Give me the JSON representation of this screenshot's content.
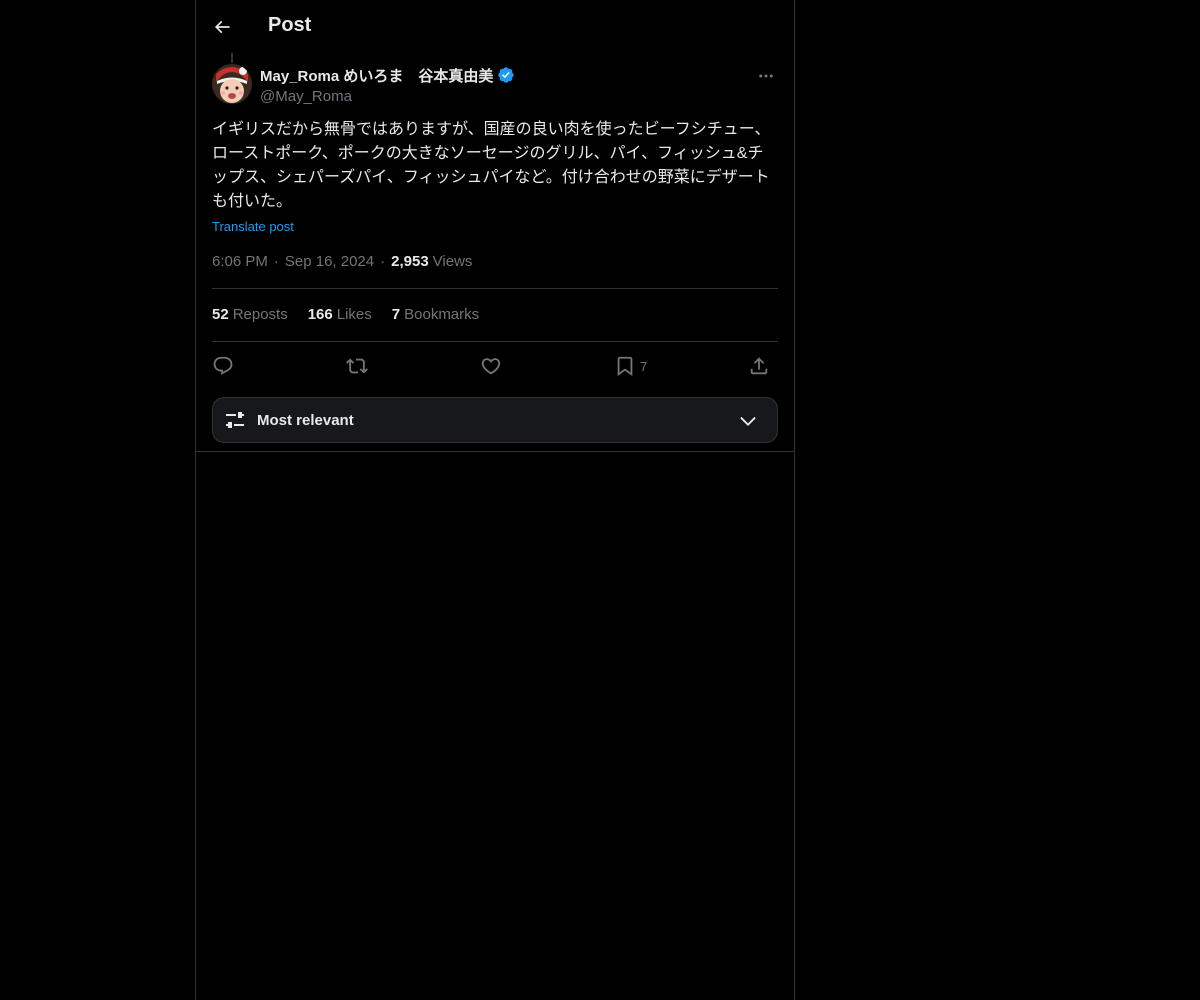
{
  "header": {
    "title": "Post",
    "back_icon": "arrow-left-icon"
  },
  "author": {
    "display_name": "May_Roma めいろま　谷本真由美",
    "handle": "@May_Roma",
    "verified": true,
    "verified_color": "#1d9bf0",
    "avatar_icon": "baby-avatar"
  },
  "post": {
    "text": "イギリスだから無骨ではありますが、国産の良い肉を使ったビーフシチュー、ローストポーク、ポークの大きなソーセージのグリル、パイ、フィッシュ&チップス、シェパーズパイ、フィッシュパイなど。付け合わせの野菜にデザートも付いた。",
    "translate_label": "Translate post",
    "time": "6:06 PM",
    "date": "Sep 16, 2024",
    "views_count": "2,953",
    "views_label": "Views"
  },
  "stats": {
    "reposts_count": "52",
    "reposts_label": "Reposts",
    "likes_count": "166",
    "likes_label": "Likes",
    "bookmarks_count": "7",
    "bookmarks_label": "Bookmarks"
  },
  "actions": {
    "reply_icon": "reply-icon",
    "repost_icon": "repost-icon",
    "like_icon": "heart-icon",
    "bookmark_icon": "bookmark-icon",
    "bookmark_count": "7",
    "share_icon": "share-icon"
  },
  "replies_sort": {
    "label": "Most relevant",
    "icon": "sliders-icon",
    "dropdown_icon": "chevron-down-icon"
  },
  "colors": {
    "background": "#000000",
    "text": "#e7e9ea",
    "secondary_text": "#71767b",
    "accent": "#1d9bf0",
    "border": "#2f3336"
  }
}
